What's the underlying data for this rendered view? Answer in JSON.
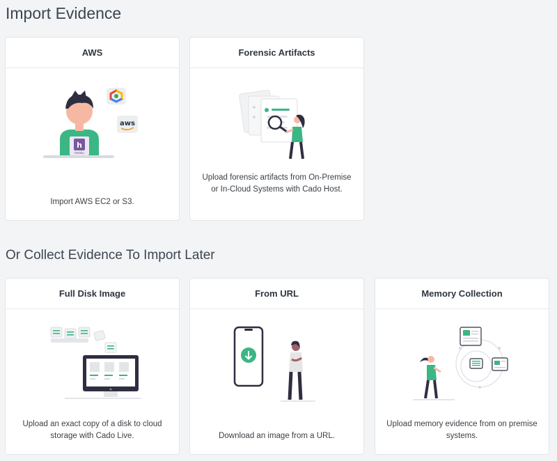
{
  "sections": {
    "import_title": "Import Evidence",
    "collect_title": "Or Collect Evidence To Import Later"
  },
  "cards": {
    "aws": {
      "title": "AWS",
      "description": "Import AWS EC2 or S3.",
      "icons": [
        "person-laptop-illustration",
        "gcp-icon",
        "aws-icon",
        "heroku-icon"
      ],
      "badges": {
        "aws": "aws",
        "heroku": "heroku"
      }
    },
    "forensic": {
      "title": "Forensic Artifacts",
      "description": "Upload forensic artifacts from On-Premise or In-Cloud Systems with Cado Host.",
      "icons": [
        "documents-magnifier-illustration"
      ]
    },
    "disk": {
      "title": "Full Disk Image",
      "description": "Upload an exact copy of a disk to cloud storage with Cado Live.",
      "icons": [
        "monitor-files-illustration"
      ]
    },
    "url": {
      "title": "From URL",
      "description": "Download an image from a URL.",
      "icons": [
        "phone-download-illustration"
      ]
    },
    "memory": {
      "title": "Memory Collection",
      "description": "Upload memory evidence from on premise systems.",
      "icons": [
        "memory-orbit-illustration"
      ]
    }
  },
  "colors": {
    "accent": "#3bb685",
    "background": "#f3f4f6",
    "card": "#ffffff",
    "dark": "#2f2e41"
  }
}
